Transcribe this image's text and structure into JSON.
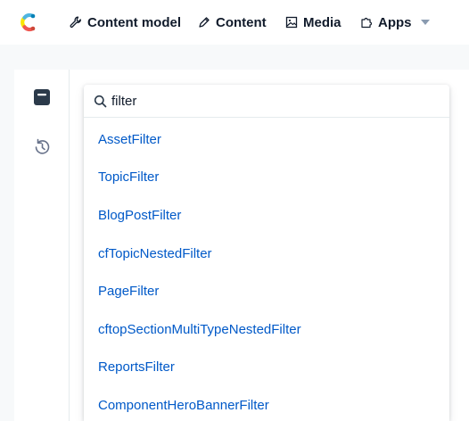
{
  "app": {
    "logo_icon": "contentful-logo"
  },
  "topnav": {
    "items": [
      {
        "label": "Content model",
        "icon": "wrench-icon"
      },
      {
        "label": "Content",
        "icon": "pen-icon"
      },
      {
        "label": "Media",
        "icon": "image-icon"
      },
      {
        "label": "Apps",
        "icon": "puzzle-icon",
        "has_dropdown": true
      }
    ]
  },
  "sidebar": {
    "items": [
      {
        "icon": "archive-icon"
      },
      {
        "icon": "history-icon"
      }
    ]
  },
  "search": {
    "value": "filter",
    "results": [
      "AssetFilter",
      "TopicFilter",
      "BlogPostFilter",
      "cfTopicNestedFilter",
      "PageFilter",
      "cftopSectionMultiTypeNestedFilter",
      "ReportsFilter",
      "ComponentHeroBannerFilter"
    ]
  },
  "colors": {
    "link": "#0059c8",
    "text": "#111b2b",
    "background": "#f7f9fa",
    "border": "#e5ebed"
  }
}
